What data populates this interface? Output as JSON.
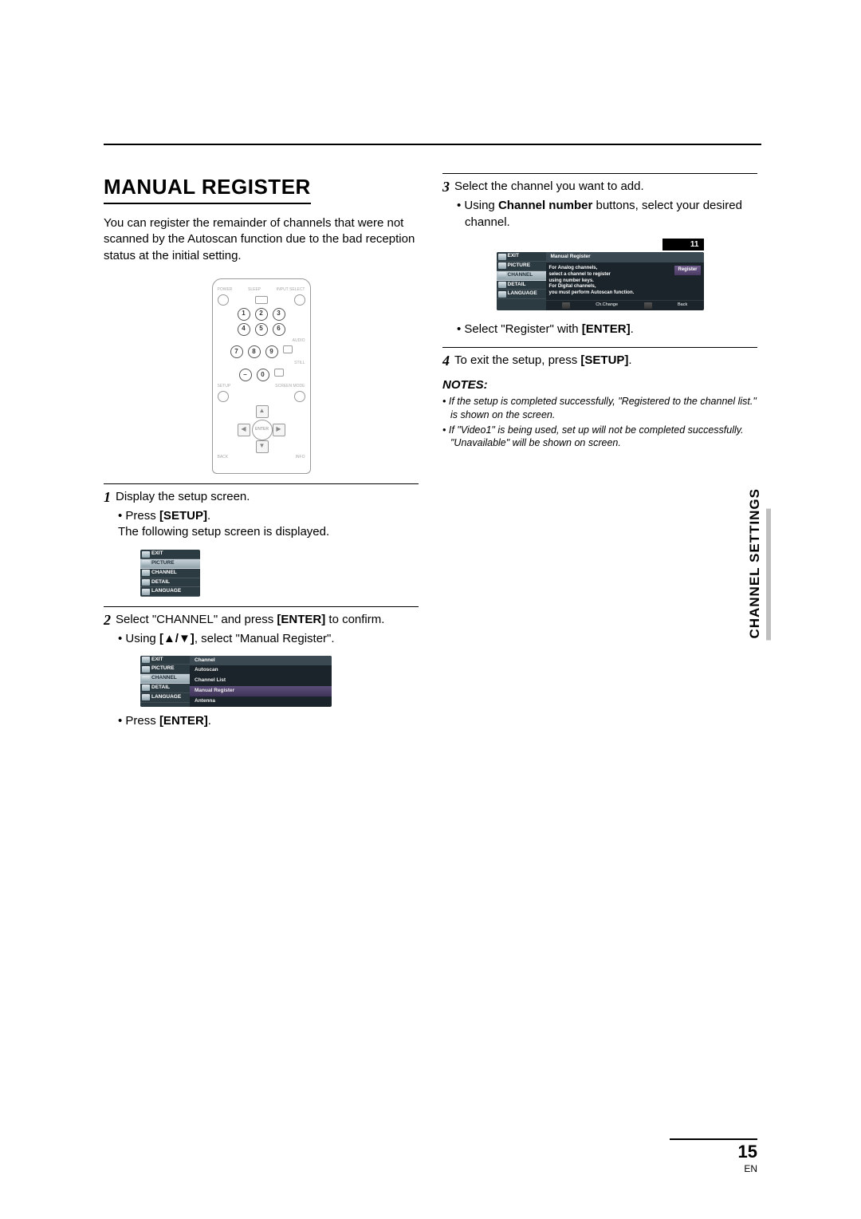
{
  "section_title": "MANUAL REGISTER",
  "side_tab": "CHANNEL SETTINGS",
  "page_number": "15",
  "page_lang": "EN",
  "intro": "You can register the remainder of channels that were not scanned by the Autoscan function due to the bad reception status at the initial setting.",
  "remote": {
    "power": "POWER",
    "sleep": "SLEEP",
    "input": "INPUT SELECT",
    "keys": [
      "1",
      "2",
      "3",
      "4",
      "5",
      "6",
      "7",
      "8",
      "9",
      "–",
      "0"
    ],
    "audio": "AUDIO",
    "still": "STILL",
    "setup": "SETUP",
    "mode": "SCREEN MODE",
    "enter": "ENTER",
    "back": "BACK",
    "info": "INFO"
  },
  "step1": {
    "text": "Display the setup screen.",
    "b1a": "Press ",
    "b1b": "[SETUP]",
    "b1c": ".",
    "sub": "The following setup screen is displayed."
  },
  "osd_menu": {
    "items": [
      "EXIT",
      "PICTURE",
      "CHANNEL",
      "DETAIL",
      "LANGUAGE"
    ]
  },
  "step2": {
    "text_a": "Select \"CHANNEL\" and press ",
    "text_b": "[ENTER]",
    "text_c": " to confirm.",
    "b1a": "Using ",
    "b1b": "[▲/▼]",
    "b1c": ", select \"Manual Register\".",
    "b2a": "Press ",
    "b2b": "[ENTER]",
    "b2c": "."
  },
  "osd_channel": {
    "header": "Channel",
    "options": [
      "Autoscan",
      "Channel List",
      "Manual Register",
      "Antenna"
    ],
    "highlight_index": 2
  },
  "step3": {
    "text": "Select the channel you want to add.",
    "b1a": "Using ",
    "b1b": "Channel number",
    "b1c": " buttons, select your desired channel.",
    "b2a": "Select \"Register\" with ",
    "b2b": "[ENTER]",
    "b2c": "."
  },
  "osd_register": {
    "channel_num": "11",
    "header": "Manual Register",
    "body_lines": [
      "For Analog channels,",
      "select a channel to register",
      "using number keys.",
      "For Digital channels,",
      "you must perform Autoscan function."
    ],
    "button": "Register",
    "foot_change": "Ch.Change",
    "foot_back": "Back"
  },
  "step4": {
    "text_a": "To exit the setup, press ",
    "text_b": "[SETUP]",
    "text_c": "."
  },
  "notes": {
    "header": "NOTES:",
    "n1": "If the setup is completed successfully, \"Registered to the channel list.\" is shown on the screen.",
    "n2": "If \"Video1\" is being used, set up will not be completed successfully. \"Unavailable\" will be shown on screen."
  }
}
